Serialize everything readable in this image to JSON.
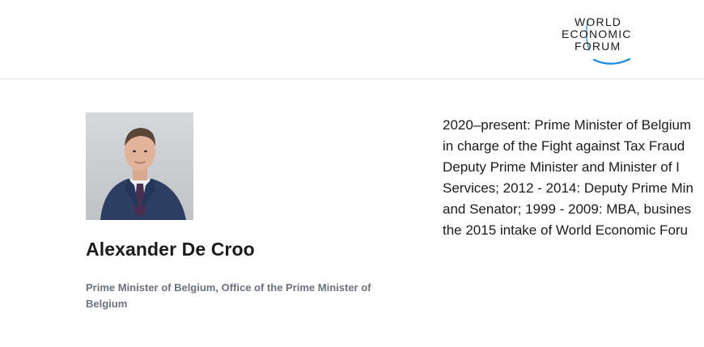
{
  "header": {
    "logo": {
      "name": "World Economic Forum logo",
      "line1": "WORLD",
      "line2": "ECONOMIC",
      "line3": "FORUM",
      "arc_color": "#1a88e0"
    }
  },
  "profile": {
    "name": "Alexander De Croo",
    "title": "Prime Minister of Belgium, Office of the Prime Minister of Belgium",
    "photo_icon": "person-portrait-photo"
  },
  "bio": {
    "lines": [
      "2020–present: Prime Minister of Belgium",
      "in charge of the Fight against Tax Fraud",
      "Deputy Prime Minister and Minister of I",
      "Services; 2012 - 2014: Deputy Prime Min",
      "and Senator; 1999 - 2009: MBA, busines",
      "the 2015 intake of World Economic Foru"
    ]
  },
  "colors": {
    "text": "#1b1b1b",
    "muted": "#6b7280",
    "divider": "#e3e5e8",
    "brand_blue": "#1a88e0"
  }
}
